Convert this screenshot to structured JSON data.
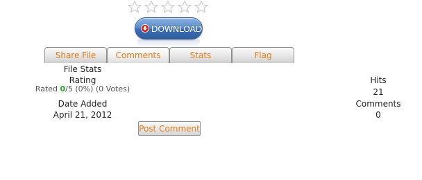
{
  "rating_stars": {
    "max": 5,
    "filled": 0
  },
  "download": {
    "label": "DOWNLOAD",
    "icon": "download-arrow-icon"
  },
  "tabs": [
    {
      "label": "Share File"
    },
    {
      "label": "Comments"
    },
    {
      "label": "Stats"
    },
    {
      "label": "Flag"
    }
  ],
  "stats": {
    "section_title": "File Stats",
    "rating_label": "Rating",
    "rated_prefix": "Rated ",
    "rated_value": "0",
    "rated_suffix": "/5 (0%) (0 Votes)",
    "date_label": "Date Added",
    "date_value": "April 21, 2012",
    "hits_label": "Hits",
    "hits_value": "21",
    "comments_label": "Comments",
    "comments_value": "0"
  },
  "post_comment": {
    "label": "Post Comment"
  },
  "colors": {
    "tab_text": "#e07c1c",
    "download_blue": "#3e6fb4",
    "download_icon_red": "#c8271e",
    "rated_green": "#1faa1f"
  }
}
